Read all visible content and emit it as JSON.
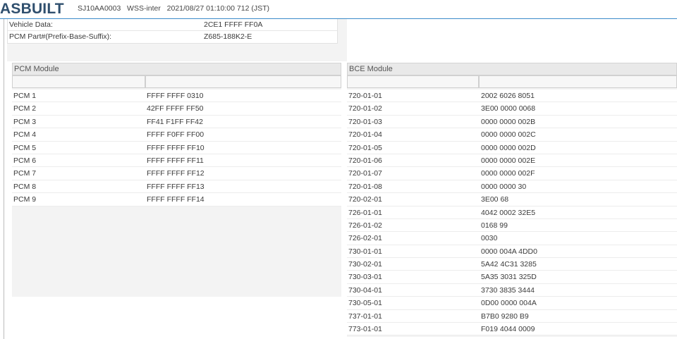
{
  "header": {
    "title": "ASBUILT",
    "meta": "SJ10AA0003   WSS-inter   2021/08/27 01:10:00 712 (JST)"
  },
  "info": [
    {
      "label": "Vehicle Data:",
      "value": "2CE1 FFFF FF0A"
    },
    {
      "label": "PCM Part#(Prefix-Base-Suffix):",
      "value": "Z685-188K2-E"
    }
  ],
  "pcm": {
    "title": "PCM Module",
    "rows": [
      {
        "name": "PCM 1",
        "value": "FFFF FFFF 0310"
      },
      {
        "name": "PCM 2",
        "value": "42FF FFFF FF50"
      },
      {
        "name": "PCM 3",
        "value": "FF41 F1FF FF42"
      },
      {
        "name": "PCM 4",
        "value": "FFFF F0FF FF00"
      },
      {
        "name": "PCM 5",
        "value": "FFFF FFFF FF10"
      },
      {
        "name": "PCM 6",
        "value": "FFFF FFFF FF11"
      },
      {
        "name": "PCM 7",
        "value": "FFFF FFFF FF12"
      },
      {
        "name": "PCM 8",
        "value": "FFFF FFFF FF13"
      },
      {
        "name": "PCM 9",
        "value": "FFFF FFFF FF14"
      }
    ]
  },
  "bce": {
    "title": "BCE Module",
    "rows": [
      {
        "name": "720-01-01",
        "value": "2002 6026 8051"
      },
      {
        "name": "720-01-02",
        "value": "3E00 0000 0068"
      },
      {
        "name": "720-01-03",
        "value": "0000 0000 002B"
      },
      {
        "name": "720-01-04",
        "value": "0000 0000 002C"
      },
      {
        "name": "720-01-05",
        "value": "0000 0000 002D"
      },
      {
        "name": "720-01-06",
        "value": "0000 0000 002E"
      },
      {
        "name": "720-01-07",
        "value": "0000 0000 002F"
      },
      {
        "name": "720-01-08",
        "value": "0000 0000 30"
      },
      {
        "name": "720-02-01",
        "value": "3E00 68"
      },
      {
        "name": "726-01-01",
        "value": "4042 0002 32E5"
      },
      {
        "name": "726-01-02",
        "value": "0168 99"
      },
      {
        "name": "726-02-01",
        "value": "0030"
      },
      {
        "name": "730-01-01",
        "value": "0000 004A 4DD0"
      },
      {
        "name": "730-02-01",
        "value": "5A42 4C31 3285"
      },
      {
        "name": "730-03-01",
        "value": "5A35 3031 325D"
      },
      {
        "name": "730-04-01",
        "value": "3730 3835 3444"
      },
      {
        "name": "730-05-01",
        "value": "0D00 0000 004A"
      },
      {
        "name": "737-01-01",
        "value": "B7B0 9280 B9"
      },
      {
        "name": "773-01-01",
        "value": "F019 4044 0009"
      }
    ]
  }
}
